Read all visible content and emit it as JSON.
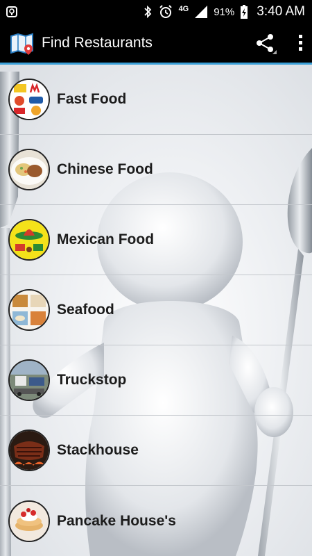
{
  "status_bar": {
    "network_type": "4G",
    "battery_percent": "91%",
    "time": "3:40 AM",
    "icons": [
      "signal-status-icon",
      "bluetooth-icon",
      "alarm-icon",
      "cell-signal-icon",
      "battery-charging-icon"
    ]
  },
  "app_bar": {
    "title": "Find Restaurants",
    "logo_icon": "map-pin-icon",
    "actions": [
      "share-icon",
      "overflow-menu-icon"
    ],
    "accent_color": "#3aa0d8"
  },
  "categories": [
    {
      "label": "Fast Food",
      "thumbnail": "fast-food-logos"
    },
    {
      "label": "Chinese Food",
      "thumbnail": "chinese-dish"
    },
    {
      "label": "Mexican Food",
      "thumbnail": "mexican-sombrero"
    },
    {
      "label": "Seafood",
      "thumbnail": "seafood-dishes"
    },
    {
      "label": "Truckstop",
      "thumbnail": "truck-stop"
    },
    {
      "label": "Stackhouse",
      "thumbnail": "grilled-steak"
    },
    {
      "label": "Pancake House's",
      "thumbnail": "pancakes-strawberries"
    }
  ]
}
